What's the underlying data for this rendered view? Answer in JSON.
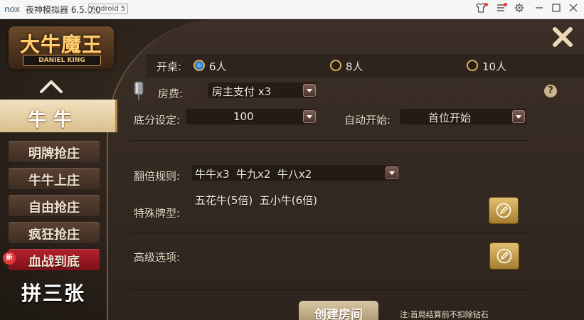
{
  "titlebar": {
    "logo": "nox",
    "title": "夜神模拟器 6.5.0.0",
    "android": "Android 5"
  },
  "logo": {
    "main": "大牛魔王",
    "sub": "DANIEL KING"
  },
  "menu": {
    "active": "牛牛",
    "items": [
      "明牌抢庄",
      "牛牛上庄",
      "自由抢庄",
      "疯狂抢庄",
      "血战到底"
    ],
    "new_badge": "新",
    "bottom": "拼三张"
  },
  "form": {
    "players_label": "开桌:",
    "players_options": [
      "6人",
      "8人",
      "10人"
    ],
    "players_selected": "6人",
    "fee_label": "房费:",
    "fee_value": "房主支付 x3",
    "base_label": "底分设定:",
    "base_value": "100",
    "autostart_label": "自动开始:",
    "autostart_value": "首位开始",
    "multiplier_label": "翻倍规则:",
    "multiplier_value": "牛牛x3  牛九x2  牛八x2",
    "special_label": "特殊牌型:",
    "special_value": "五花牛(5倍)  五小牛(6倍)",
    "advanced_label": "高级选项:",
    "help": "?"
  },
  "footer": {
    "create_label": "创建房间",
    "note": "注:首局结算前不扣除钻石"
  },
  "colors": {
    "accent_gold": "#d9b25a",
    "menu_red": "#b3222e",
    "radio_selected": "#2a7fd0"
  }
}
